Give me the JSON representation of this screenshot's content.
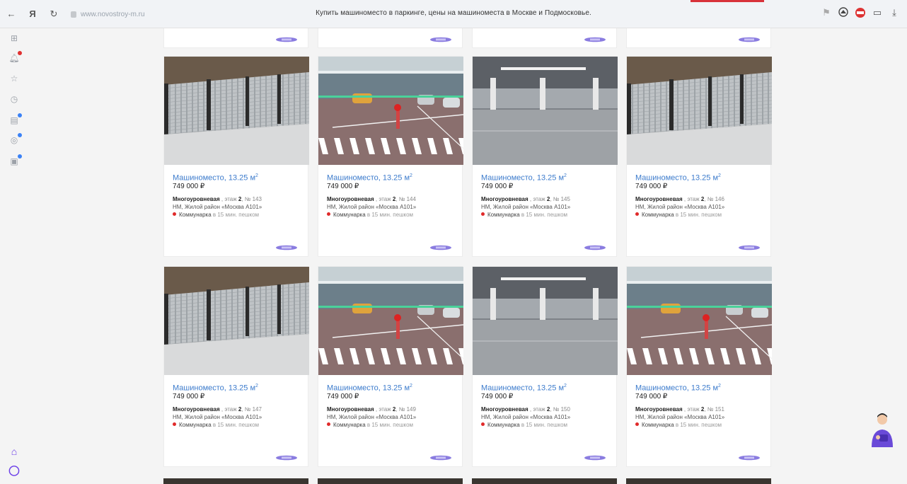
{
  "browser": {
    "url": "www.novostroy-m.ru",
    "title": "Купить машиноместо в паркинге, цены на машиноместа в Москве и Подмосковье."
  },
  "card_text": {
    "title": "Машиноместо, 13.25 м",
    "sup": "2",
    "price": "749 000 ₽",
    "type": "Многоуровневая",
    "floor_prefix": ", этаж",
    "floor": "2",
    "number_prefix": ", №",
    "complex": "НМ, Жилой район «Москва A101»",
    "metro": "Коммунарка",
    "walk": "в 15 мин. пешком"
  },
  "cards": [
    {
      "number": "143",
      "photo": "parking-mesh"
    },
    {
      "number": "144",
      "photo": "parking-cars"
    },
    {
      "number": "145",
      "photo": "parking-hall"
    },
    {
      "number": "146",
      "photo": "parking-mesh"
    },
    {
      "number": "147",
      "photo": "parking-mesh"
    },
    {
      "number": "149",
      "photo": "parking-cars"
    },
    {
      "number": "150",
      "photo": "parking-hall"
    },
    {
      "number": "151",
      "photo": "parking-cars"
    }
  ],
  "colors": {
    "link": "#3c7bcc",
    "metro_dot": "#e02a2a",
    "accent": "#6b3ee8"
  }
}
